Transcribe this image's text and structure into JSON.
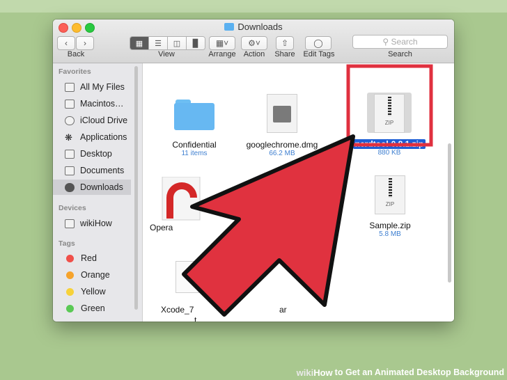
{
  "window": {
    "title": "Downloads"
  },
  "toolbar": {
    "back_label": "Back",
    "view_label": "View",
    "arrange_label": "Arrange",
    "action_label": "Action",
    "share_label": "Share",
    "edit_tags_label": "Edit Tags",
    "search_label": "Search",
    "search_placeholder": "Search"
  },
  "sidebar": {
    "favorites_header": "Favorites",
    "favorites": [
      "All My Files",
      "Macintos…",
      "iCloud Drive",
      "Applications",
      "Desktop",
      "Documents",
      "Downloads"
    ],
    "selected": "Downloads",
    "devices_header": "Devices",
    "devices": [
      "wikiHow"
    ],
    "tags_header": "Tags",
    "tags": [
      {
        "name": "Red",
        "color": "#f0504a"
      },
      {
        "name": "Orange",
        "color": "#f6a32b"
      },
      {
        "name": "Yellow",
        "color": "#f7d23a"
      },
      {
        "name": "Green",
        "color": "#5ac955"
      }
    ]
  },
  "files": [
    {
      "name": "Confidential",
      "meta": "11 items"
    },
    {
      "name": "googlechrome.dmg",
      "meta": "66.2 MB"
    },
    {
      "name": "nerdtool-0.8.1.zip",
      "meta": "880 KB",
      "selected": true
    },
    {
      "name": "Opera",
      "meta": ""
    },
    {
      "name": "Sample.zip",
      "meta": "5.8 MB"
    },
    {
      "name": "Xcode_7",
      "name_tail": "ar",
      "name_line2": "t",
      "meta": ""
    }
  ],
  "zip_label": "ZIP",
  "highlight_color": "#e0303f",
  "arrow_color": "#e0323f",
  "footer": {
    "brand": "wiki",
    "how": "How",
    "title": "to Get an Animated Desktop Background"
  }
}
